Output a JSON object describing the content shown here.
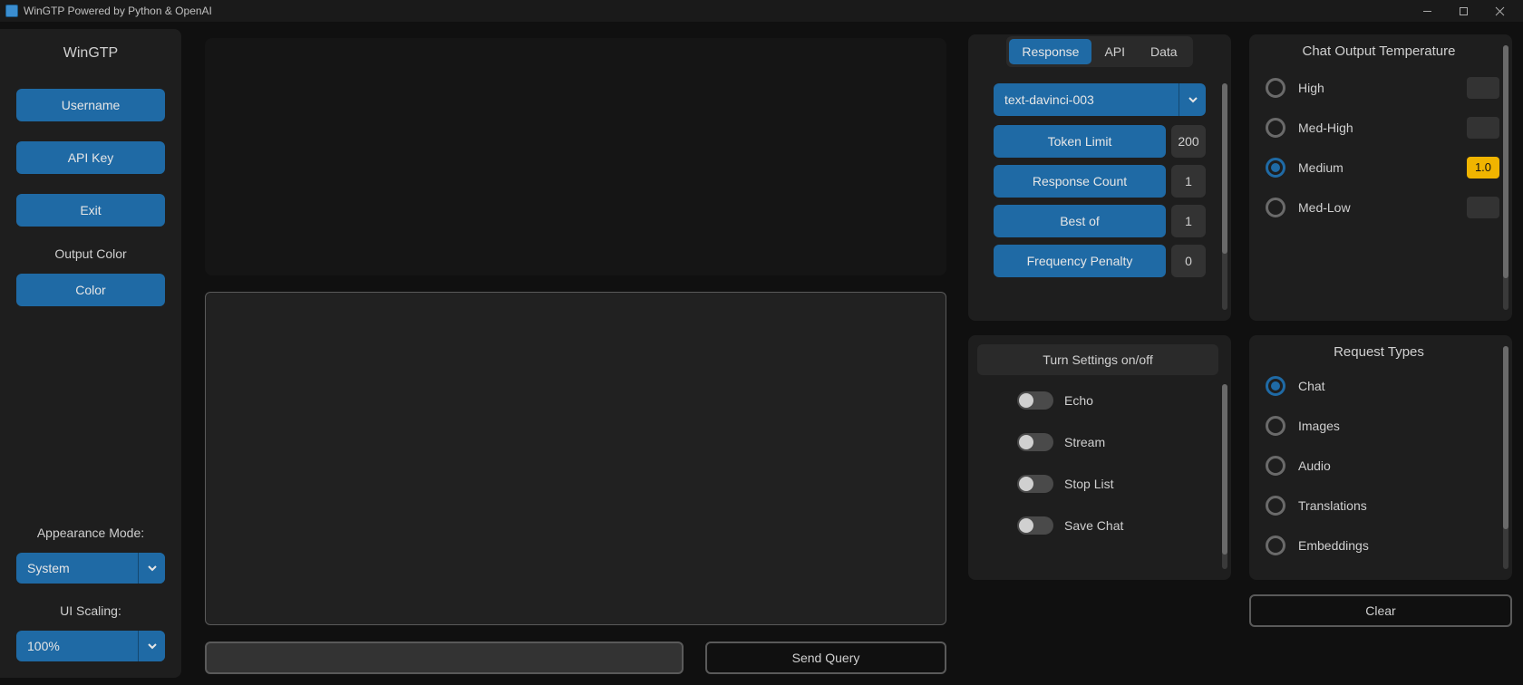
{
  "window": {
    "title": "WinGTP Powered by Python & OpenAI"
  },
  "sidebar": {
    "title": "WinGTP",
    "username": "Username",
    "apikey": "API Key",
    "exit": "Exit",
    "output_color_label": "Output Color",
    "color": "Color",
    "appearance_label": "Appearance Mode:",
    "appearance_value": "System",
    "scaling_label": "UI Scaling:",
    "scaling_value": "100%"
  },
  "center": {
    "send": "Send Query"
  },
  "tabs": {
    "response": "Response",
    "api": "API",
    "data": "Data"
  },
  "params": {
    "model": "text-davinci-003",
    "token_limit_label": "Token Limit",
    "token_limit": "200",
    "response_count_label": "Response Count",
    "response_count": "1",
    "best_of_label": "Best of",
    "best_of": "1",
    "freq_penalty_label": "Frequency Penalty",
    "freq_penalty": "0"
  },
  "temperature": {
    "title": "Chat Output Temperature",
    "high": "High",
    "medhigh": "Med-High",
    "medium": "Medium",
    "medium_val": "1.0",
    "medlow": "Med-Low"
  },
  "toggles": {
    "header": "Turn Settings on/off",
    "echo": "Echo",
    "stream": "Stream",
    "stoplist": "Stop List",
    "savechat": "Save Chat"
  },
  "request_types": {
    "title": "Request Types",
    "chat": "Chat",
    "images": "Images",
    "audio": "Audio",
    "translations": "Translations",
    "embeddings": "Embeddings"
  },
  "clear": "Clear"
}
